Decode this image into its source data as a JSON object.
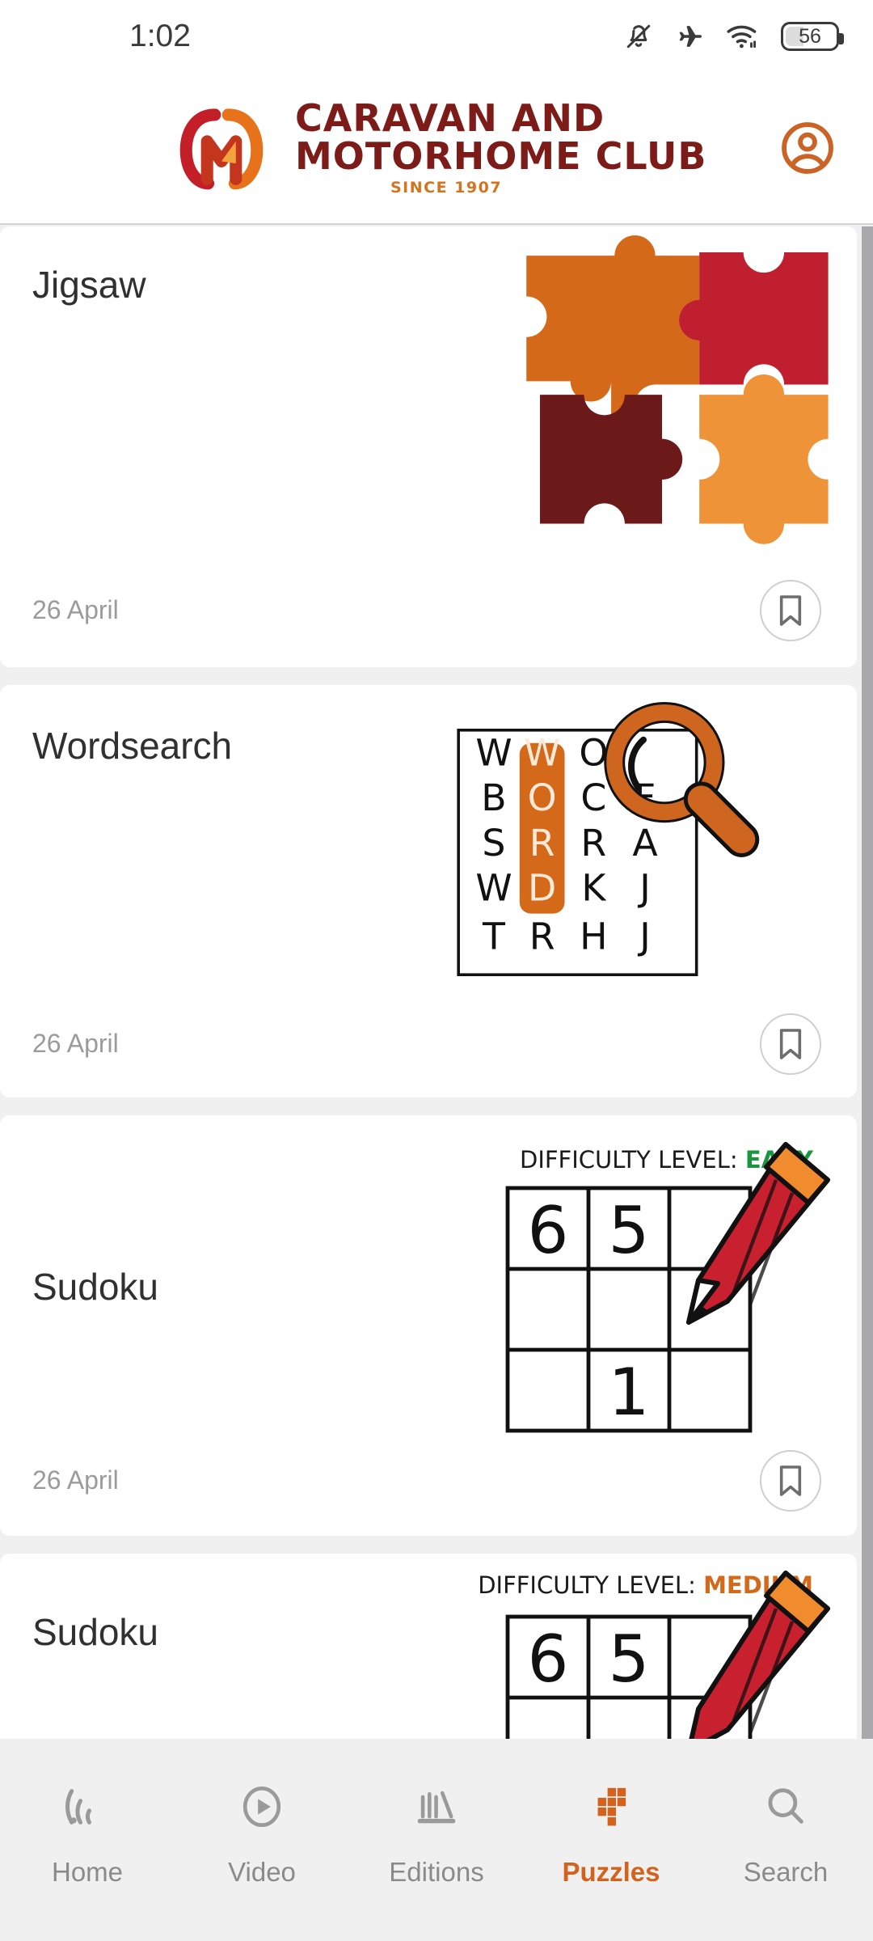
{
  "statusbar": {
    "time": "1:02",
    "battery_level": "56",
    "icons": [
      "bell-off-icon",
      "airplane-mode-icon",
      "wifi-icon",
      "battery-icon"
    ]
  },
  "header": {
    "logo_line1": "CARAVAN AND",
    "logo_line2": "MOTORHOME CLUB",
    "logo_since": "SINCE 1907",
    "account_icon": "account-circle-icon",
    "brand_maroon": "#7d1b18",
    "brand_orange": "#d4741f",
    "brand_red": "#c41e28"
  },
  "cards": [
    {
      "title": "Jigsaw",
      "date": "26 April",
      "bookmark_icon": "bookmark-icon",
      "art": "jigsaw-pieces",
      "piece_colors": [
        "#d4691a",
        "#bf1f2e",
        "#6b1919",
        "#ef9338"
      ]
    },
    {
      "title": "Wordsearch",
      "date": "26 April",
      "bookmark_icon": "bookmark-icon",
      "art": "wordsearch-grid",
      "grid": [
        [
          "W",
          "W",
          "O",
          ""
        ],
        [
          "B",
          "O",
          "C",
          "F"
        ],
        [
          "S",
          "R",
          "R",
          "A"
        ],
        [
          "W",
          "D",
          "K",
          "J"
        ],
        [
          "T",
          "R",
          "H",
          "J"
        ]
      ],
      "highlight_word": "WORD",
      "highlight_column": 1,
      "highlight_rows": [
        0,
        1,
        2,
        3
      ],
      "highlight_color": "#d4691a"
    },
    {
      "title": "Sudoku",
      "date": "26 April",
      "bookmark_icon": "bookmark-icon",
      "art": "sudoku-grid",
      "difficulty_label": "DIFFICULTY LEVEL:",
      "difficulty_value": "EASY",
      "difficulty_color": "#1a9641",
      "grid": [
        [
          "6",
          "5",
          ""
        ],
        [
          "",
          "",
          ""
        ],
        [
          "",
          "1",
          ""
        ]
      ]
    },
    {
      "title": "Sudoku",
      "date": "",
      "art": "sudoku-grid",
      "difficulty_label": "DIFFICULTY LEVEL:",
      "difficulty_value": "MEDIUM",
      "difficulty_color": "#d4691a",
      "grid": [
        [
          "6",
          "5",
          ""
        ],
        [
          "",
          "",
          ""
        ],
        [
          "",
          "",
          ""
        ]
      ]
    }
  ],
  "bottomnav": {
    "items": [
      {
        "label": "Home",
        "icon": "rss-icon",
        "active": false
      },
      {
        "label": "Video",
        "icon": "play-circle-icon",
        "active": false
      },
      {
        "label": "Editions",
        "icon": "editions-icon",
        "active": false
      },
      {
        "label": "Puzzles",
        "icon": "puzzles-grid-icon",
        "active": true
      },
      {
        "label": "Search",
        "icon": "search-icon",
        "active": false
      }
    ],
    "active_color": "#d4621d",
    "inactive_color": "#8a8a8a"
  }
}
